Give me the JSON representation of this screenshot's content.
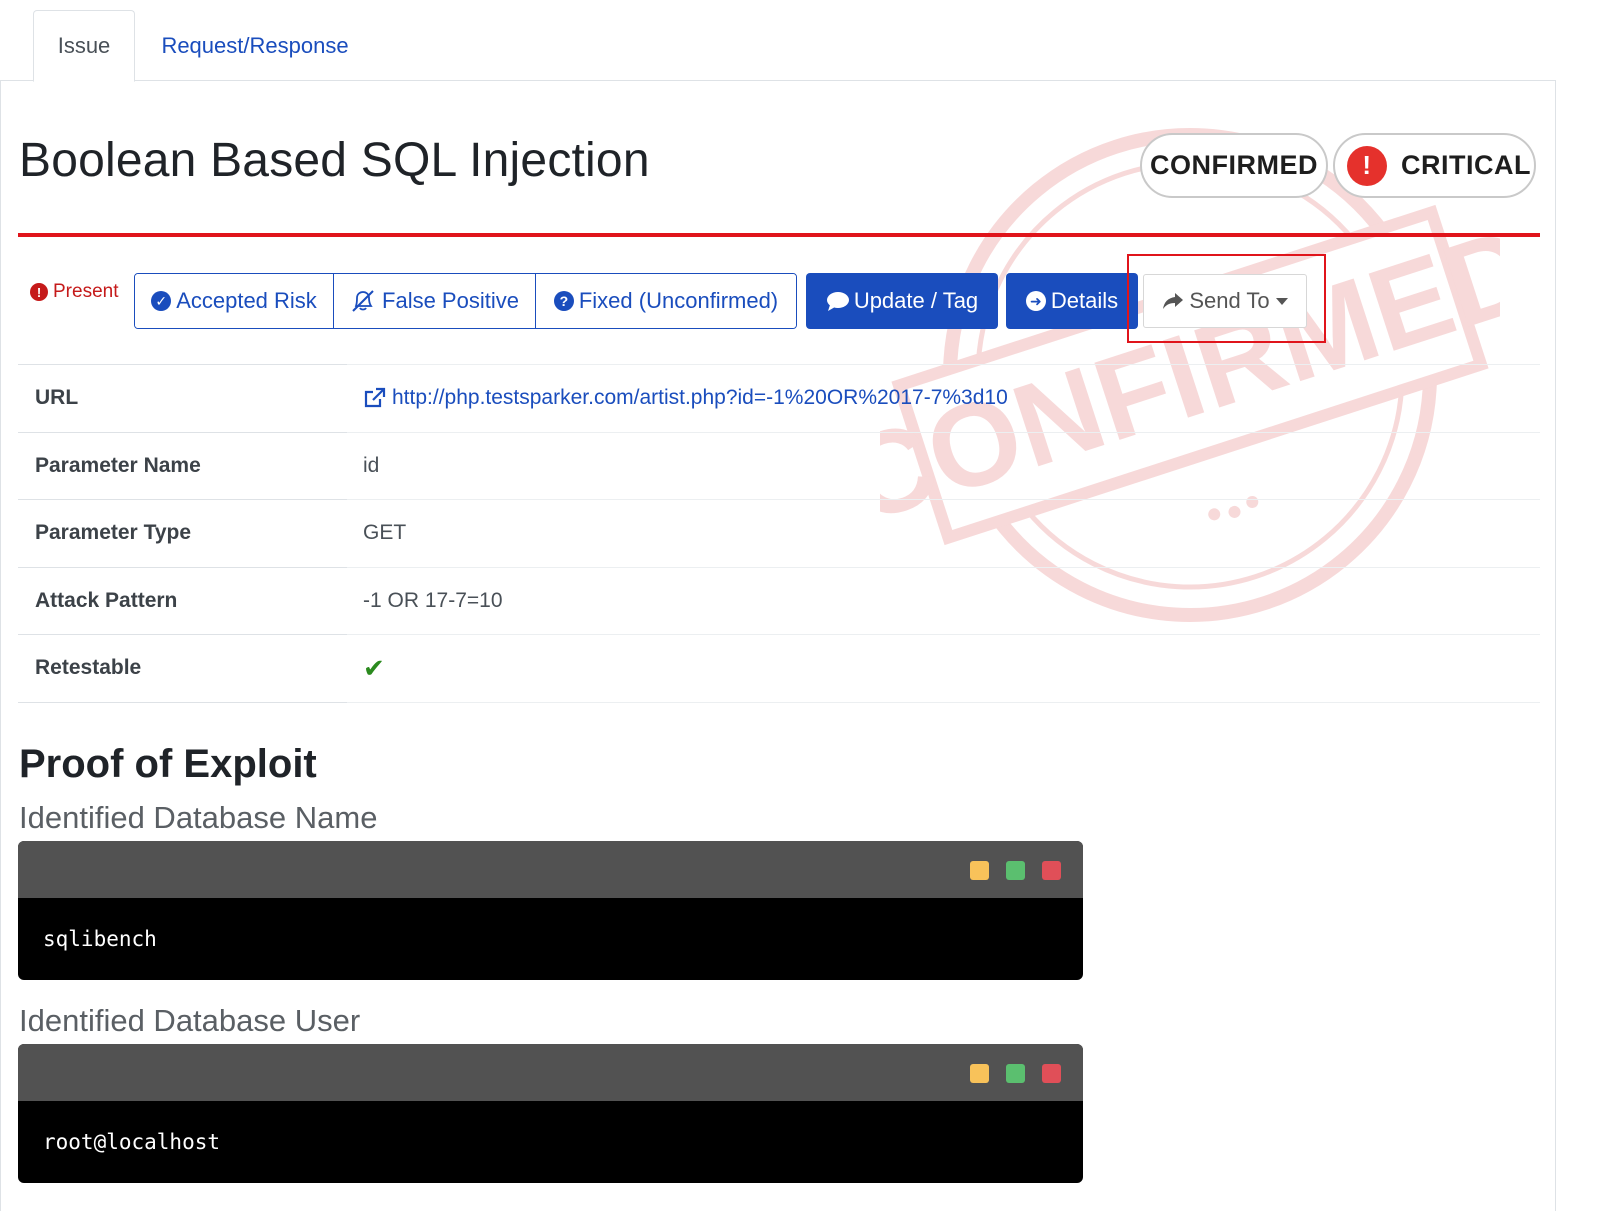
{
  "tabs": [
    {
      "label": "Issue"
    },
    {
      "label": "Request/Response"
    }
  ],
  "issue": {
    "title": "Boolean Based SQL Injection",
    "state_badge": "CONFIRMED",
    "severity_badge": "CRITICAL",
    "watermark_text": "CONFIRMED"
  },
  "actions": {
    "status": "Present",
    "accepted_risk": "Accepted Risk",
    "false_positive": "False Positive",
    "fixed_unconfirmed": "Fixed (Unconfirmed)",
    "update_tag": "Update / Tag",
    "details": "Details",
    "send_to": "Send To"
  },
  "details": [
    {
      "label": "URL",
      "value": "http://php.testsparker.com/artist.php?id=-1%20OR%2017-7%3d10"
    },
    {
      "label": "Parameter Name",
      "value": "id"
    },
    {
      "label": "Parameter Type",
      "value": "GET"
    },
    {
      "label": "Attack Pattern",
      "value": "-1 OR 17-7=10"
    },
    {
      "label": "Retestable",
      "value": "✔"
    }
  ],
  "proof": {
    "title": "Proof of Exploit",
    "sections": [
      {
        "heading": "Identified Database Name",
        "output": "sqlibench"
      },
      {
        "heading": "Identified Database User",
        "output": "root@localhost"
      }
    ]
  },
  "colors": {
    "primary": "#1a4dbd",
    "danger": "#e0141b",
    "critical_dot": "#e5312c",
    "success": "#2b8a1e"
  }
}
